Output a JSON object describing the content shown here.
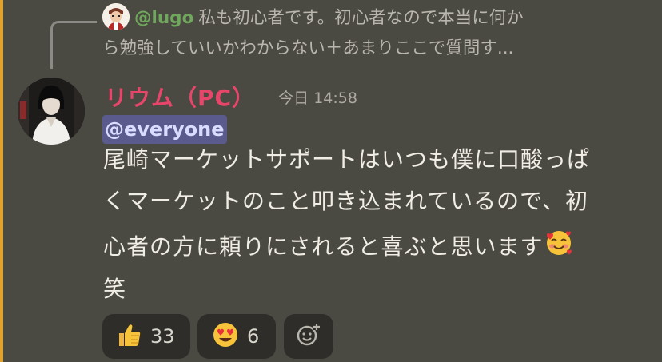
{
  "reply": {
    "author": "@lugo",
    "text_line1": "私も初心者です。初心者なので本当に何か",
    "text_line2": "ら勉強していいかわからない＋あまりここで質問す..."
  },
  "message": {
    "author": "リウム（PC）",
    "timestamp": "今日 14:58",
    "mention": "@everyone",
    "lines": [
      "尾崎マーケットサポートはいつも僕に口酸っぱ",
      "くマーケットのこと叩き込まれているので、初",
      "心者の方に頼りにされると喜ぶと思います",
      "笑"
    ],
    "inline_emoji": "smiling-face-with-hearts-icon"
  },
  "reactions": [
    {
      "icon": "thumbs-up-icon",
      "count": "33"
    },
    {
      "icon": "heart-eyes-icon",
      "count": "6"
    },
    {
      "icon": "add-reaction-icon"
    }
  ],
  "colors": {
    "background": "#4a4942",
    "mention_bar": "#e0a22c",
    "username": "#e8456a",
    "reply_author": "#6fa85c",
    "mention_bg": "#5a5a8c",
    "reaction_bg": "#2e2d29"
  }
}
